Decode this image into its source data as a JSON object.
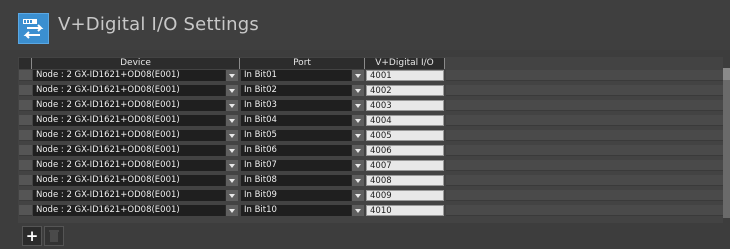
{
  "header": {
    "title": "V+Digital I/O Settings",
    "icon": "io-transfer-icon",
    "accent": "#3b8fd0"
  },
  "grid": {
    "columns": [
      "Device",
      "Port",
      "V+Digital I/O"
    ],
    "rows": [
      {
        "device": "Node : 2 GX-ID1621+OD08(E001)",
        "port": "In Bit01",
        "vdio": "4001"
      },
      {
        "device": "Node : 2 GX-ID1621+OD08(E001)",
        "port": "In Bit02",
        "vdio": "4002"
      },
      {
        "device": "Node : 2 GX-ID1621+OD08(E001)",
        "port": "In Bit03",
        "vdio": "4003"
      },
      {
        "device": "Node : 2 GX-ID1621+OD08(E001)",
        "port": "In Bit04",
        "vdio": "4004"
      },
      {
        "device": "Node : 2 GX-ID1621+OD08(E001)",
        "port": "In Bit05",
        "vdio": "4005"
      },
      {
        "device": "Node : 2 GX-ID1621+OD08(E001)",
        "port": "In Bit06",
        "vdio": "4006"
      },
      {
        "device": "Node : 2 GX-ID1621+OD08(E001)",
        "port": "In Bit07",
        "vdio": "4007"
      },
      {
        "device": "Node : 2 GX-ID1621+OD08(E001)",
        "port": "In Bit08",
        "vdio": "4008"
      },
      {
        "device": "Node : 2 GX-ID1621+OD08(E001)",
        "port": "In Bit09",
        "vdio": "4009"
      },
      {
        "device": "Node : 2 GX-ID1621+OD08(E001)",
        "port": "In Bit10",
        "vdio": "4010"
      }
    ]
  },
  "toolbar": {
    "add_label": "+",
    "delete_icon": "trash-icon"
  }
}
